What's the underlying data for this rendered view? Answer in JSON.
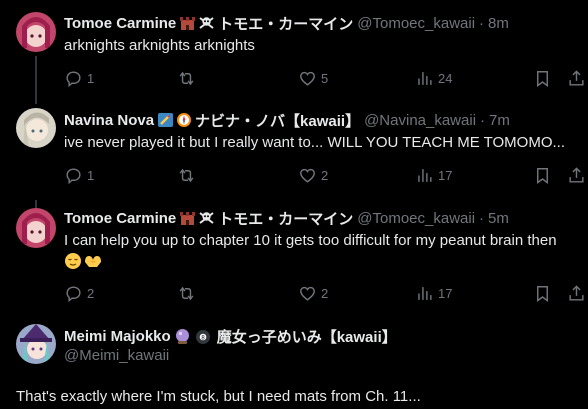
{
  "tweets": [
    {
      "name": "Tomoe Carmine",
      "jp_name": "トモエ・カーマイン",
      "handle": "@Tomoec_kawaii",
      "time": "8m",
      "text": "arknights arknights arknights",
      "replies": "1",
      "retweets": "",
      "likes": "5",
      "views": "24"
    },
    {
      "name": "Navina Nova",
      "jp_name": "ナビナ・ノバ【kawaii】",
      "handle": "@Navina_kawaii",
      "time": "7m",
      "text": "ive never played it but I really want to... WILL YOU TEACH ME TOMOMO...",
      "replies": "1",
      "retweets": "",
      "likes": "2",
      "views": "17"
    },
    {
      "name": "Tomoe Carmine",
      "jp_name": "トモエ・カーマイン",
      "handle": "@Tomoec_kawaii",
      "time": "5m",
      "text": "I can help you up to chapter 10 it gets too difficult for my peanut brain then",
      "emoji_line": "😌🫶",
      "replies": "2",
      "retweets": "",
      "likes": "2",
      "views": "17"
    },
    {
      "name": "Meimi Majokko",
      "jp_name": "魔女っ子めいみ【kawaii】",
      "handle": "@Meimi_kawaii",
      "text": "That's exactly where I'm stuck, but I need mats from Ch. 11..."
    }
  ],
  "icons": {
    "reply": "reply-icon",
    "retweet": "retweet-icon",
    "like": "heart-icon",
    "views": "views-icon",
    "bookmark": "bookmark-icon",
    "share": "share-icon"
  },
  "colors": {
    "background": "#000000",
    "text": "#e7e9ea",
    "muted": "#71767b",
    "thread_line": "#333639"
  }
}
